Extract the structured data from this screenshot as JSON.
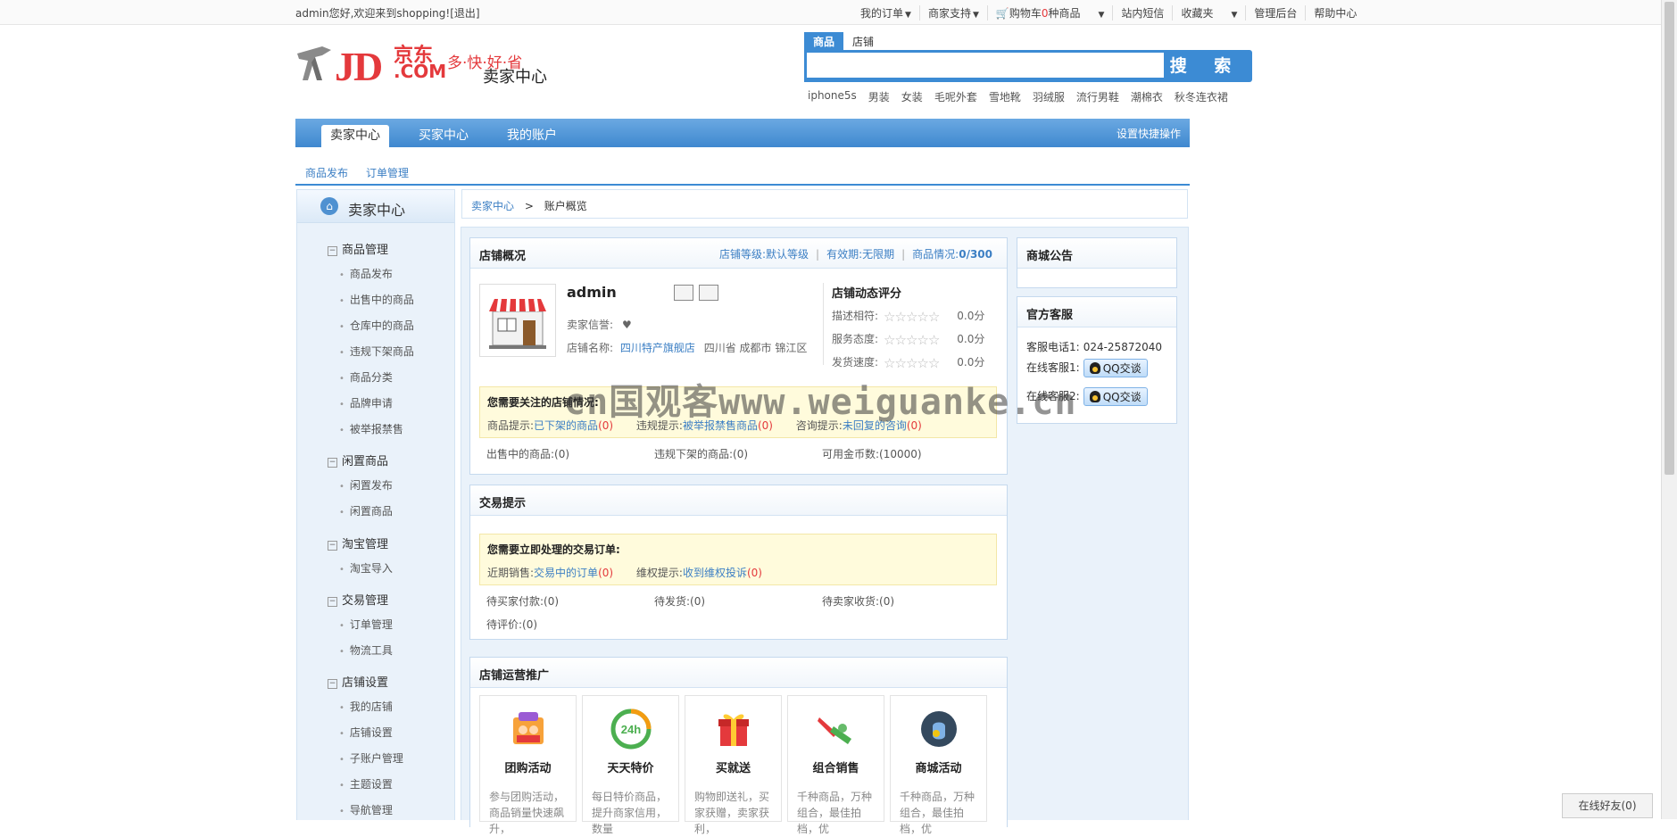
{
  "topbar": {
    "welcome": "admin您好,欢迎来到shopping!",
    "logout": "[退出]",
    "links": {
      "my_orders": "我的订单",
      "merchant_support": "商家支持",
      "cart_prefix": "购物车",
      "cart_count": "0",
      "cart_suffix": "种商品",
      "messages": "站内短信",
      "favorites": "收藏夹",
      "admin": "管理后台",
      "help": "帮助中心"
    }
  },
  "logo": {
    "jd": "JD",
    "cn": "京东",
    "com": ".COM",
    "slogan": "多·快·好·省",
    "subtitle": "卖家中心"
  },
  "search": {
    "tab_goods": "商品",
    "tab_store": "店铺",
    "placeholder": "",
    "button": "搜 索",
    "hotwords": [
      "iphone5s",
      "男装",
      "女装",
      "毛呢外套",
      "雪地靴",
      "羽绒服",
      "流行男鞋",
      "潮棉衣",
      "秋冬连衣裙"
    ]
  },
  "mainnav": {
    "tabs": [
      "卖家中心",
      "买家中心",
      "我的账户"
    ],
    "quick_setting": "设置快捷操作"
  },
  "subnav": [
    "商品发布",
    "订单管理"
  ],
  "sidebar": {
    "title": "卖家中心",
    "groups": [
      {
        "label": "商品管理",
        "items": [
          "商品发布",
          "出售中的商品",
          "仓库中的商品",
          "违规下架商品",
          "商品分类",
          "品牌申请",
          "被举报禁售"
        ]
      },
      {
        "label": "闲置商品",
        "items": [
          "闲置发布",
          "闲置商品"
        ]
      },
      {
        "label": "淘宝管理",
        "items": [
          "淘宝导入"
        ]
      },
      {
        "label": "交易管理",
        "items": [
          "订单管理",
          "物流工具"
        ]
      },
      {
        "label": "店铺设置",
        "items": [
          "我的店铺",
          "店铺设置",
          "子账户管理",
          "主题设置",
          "导航管理"
        ]
      }
    ]
  },
  "breadcrumb": {
    "root": "卖家中心",
    "sep": ">",
    "current": "账户概览"
  },
  "overview": {
    "title": "店铺概况",
    "level_label": "店铺等级:",
    "level_value": "默认等级",
    "valid_label": "有效期:",
    "valid_value": "无限期",
    "goods_label": "商品情况:",
    "goods_value": "0/300",
    "username": "admin",
    "credit_label": "卖家信誉:",
    "store_label": "店铺名称:",
    "store_name": "四川特产旗舰店",
    "store_location": "四川省 成都市 锦江区",
    "rating_title": "店铺动态评分",
    "ratings": [
      {
        "label": "描述相符:",
        "score": "0.0分",
        "value": 0
      },
      {
        "label": "服务态度:",
        "score": "0.0分",
        "value": 0
      },
      {
        "label": "发货速度:",
        "score": "0.0分",
        "value": 0
      }
    ],
    "notice_title": "您需要关注的店铺情况:",
    "notice": {
      "goods_label": "商品提示:",
      "goods_link": "已下架的商品",
      "goods_count": "(0)",
      "violation_label": "违规提示:",
      "violation_link": "被举报禁售商品",
      "violation_count": "(0)",
      "consult_label": "咨询提示:",
      "consult_link": "未回复的咨询",
      "consult_count": "(0)"
    },
    "stats": [
      "出售中的商品:(0)",
      "违规下架的商品:(0)",
      "可用金币数:(10000)"
    ]
  },
  "trade": {
    "title": "交易提示",
    "notice_title": "您需要立即处理的交易订单:",
    "sales_label": "近期销售:",
    "sales_link": "交易中的订单",
    "sales_count": "(0)",
    "rights_label": "维权提示:",
    "rights_link": "收到维权投诉",
    "rights_count": "(0)",
    "stats": [
      "待买家付款:(0)",
      "待发货:(0)",
      "待卖家收货:(0)",
      "待评价:(0)"
    ]
  },
  "promotion": {
    "title": "店铺运营推广",
    "cards": [
      {
        "name": "团购活动",
        "desc": "参与团购活动，商品销量快速飙升，",
        "icon": "group-buy-icon"
      },
      {
        "name": "天天特价",
        "desc": "每日特价商品，提升商家信用，数量",
        "icon": "24h-icon"
      },
      {
        "name": "买就送",
        "desc": "购物即送礼，买家获赠，卖家获利，",
        "icon": "gift-icon"
      },
      {
        "name": "组合销售",
        "desc": "千种商品，万种组合，最佳拍档，优",
        "icon": "combo-icon"
      },
      {
        "name": "商城活动",
        "desc": "千种商品，万种组合，最佳拍档，优",
        "icon": "mall-activity-icon"
      }
    ]
  },
  "announcement": {
    "title": "商城公告"
  },
  "service": {
    "title": "官方客服",
    "phone_label": "客服电话1:",
    "phone": "024-25872040",
    "online1_label": "在线客服1:",
    "online2_label": "在线客服2:",
    "qq_button": "QQ交谈"
  },
  "friends": "在线好友(0)",
  "watermark": "cn国观客www.weiguanke.cn",
  "colors": {
    "brand_red": "#e4393c",
    "accent_blue": "#3c8bd4",
    "link_blue": "#3c7fc4"
  }
}
